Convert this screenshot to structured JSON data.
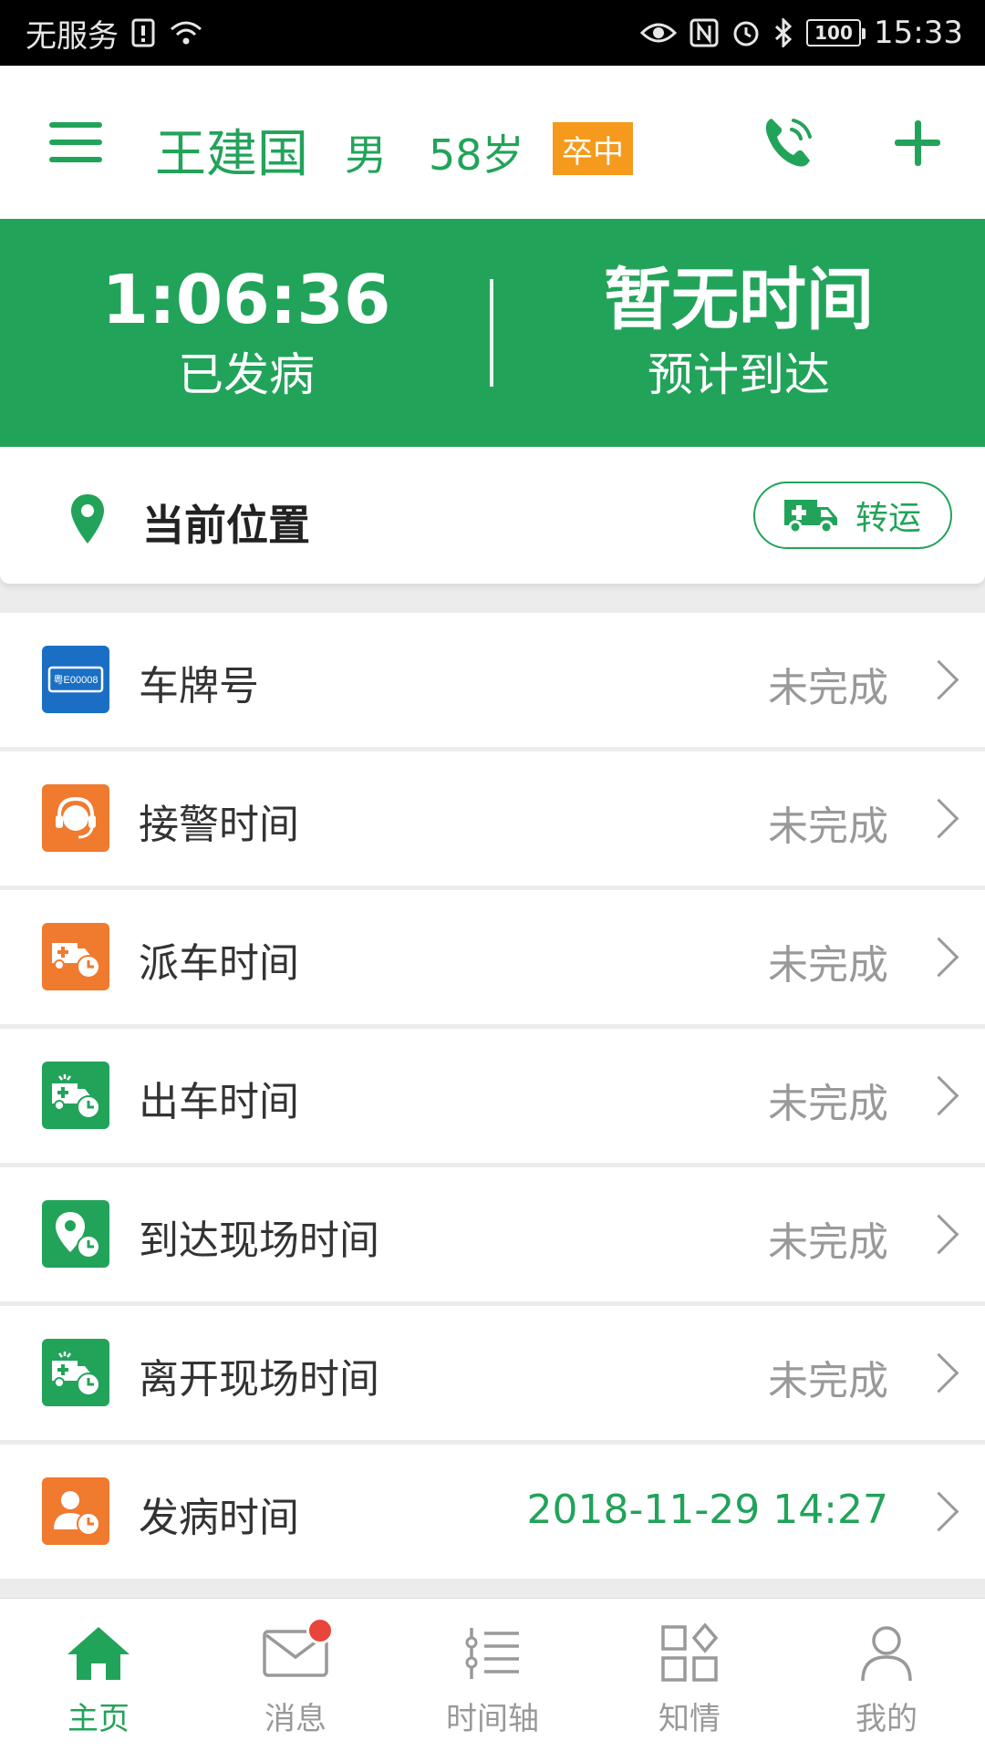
{
  "status_bar": {
    "carrier": "无服务",
    "battery": "100",
    "time": "15:33"
  },
  "header": {
    "patient_name": "王建国",
    "sex": "男",
    "age": "58岁",
    "diagnosis_badge": "卒中",
    "icons": [
      "menu-icon",
      "phone-icon",
      "plus-icon"
    ]
  },
  "banner": {
    "onset_elapsed": "1:06:36",
    "onset_label": "已发病",
    "eta_value": "暂无时间",
    "eta_label": "预计到达"
  },
  "location": {
    "title": "当前位置",
    "transfer_label": "转运"
  },
  "items": [
    {
      "label": "车牌号",
      "status": "未完成",
      "icon": "license-plate-icon",
      "icon_color": "#1a6fc4",
      "plate_text": "粤E00008"
    },
    {
      "label": "接警时间",
      "status": "未完成",
      "icon": "headset-icon",
      "icon_color": "#f07a2e"
    },
    {
      "label": "派车时间",
      "status": "未完成",
      "icon": "ambulance-clock-icon",
      "icon_color": "#f07a2e"
    },
    {
      "label": "出车时间",
      "status": "未完成",
      "icon": "ambulance-clock-icon",
      "icon_color": "#22a35a"
    },
    {
      "label": "到达现场时间",
      "status": "未完成",
      "icon": "location-clock-icon",
      "icon_color": "#22a35a"
    },
    {
      "label": "离开现场时间",
      "status": "未完成",
      "icon": "ambulance-clock-icon",
      "icon_color": "#22a35a"
    },
    {
      "label": "发病时间",
      "status": "2018-11-29 14:27",
      "icon": "person-clock-icon",
      "icon_color": "#f07a2e"
    }
  ],
  "nav": [
    {
      "label": "主页",
      "icon": "home-icon",
      "active": true
    },
    {
      "label": "消息",
      "icon": "mail-icon",
      "has_badge": true
    },
    {
      "label": "时间轴",
      "icon": "timeline-icon"
    },
    {
      "label": "知情",
      "icon": "grid-icon"
    },
    {
      "label": "我的",
      "icon": "user-icon"
    }
  ],
  "colors": {
    "primary": "#22a35a",
    "badge_orange": "#f59a1c",
    "notify_red": "#e8453c"
  }
}
